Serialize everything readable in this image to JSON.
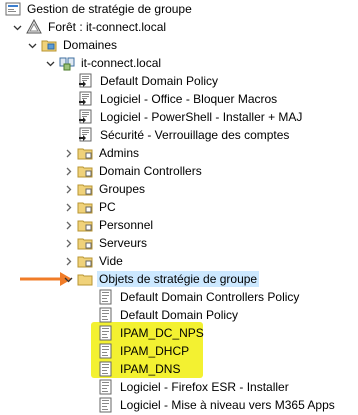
{
  "tree": {
    "root": "Gestion de stratégie de groupe",
    "forest": "Forêt : it-connect.local",
    "domains": "Domaines",
    "domain": "it-connect.local",
    "links": [
      "Default Domain Policy",
      "Logiciel - Office - Bloquer Macros",
      "Logiciel - PowerShell - Installer + MAJ",
      "Sécurité - Verrouillage des comptes"
    ],
    "ous": [
      "Admins",
      "Domain Controllers",
      "Groupes",
      "PC",
      "Personnel",
      "Serveurs",
      "Vide"
    ],
    "gpo_container": "Objets de stratégie de groupe",
    "gpos": [
      "Default Domain Controllers Policy",
      "Default Domain Policy",
      "IPAM_DC_NPS",
      "IPAM_DHCP",
      "IPAM_DNS",
      "Logiciel - Firefox ESR - Installer",
      "Logiciel - Mise à niveau vers M365 Apps"
    ]
  },
  "colors": {
    "highlight": "#f3f131",
    "arrow": "#f07c28",
    "selection": "#cce8ff",
    "folder": "#e9c46a"
  }
}
